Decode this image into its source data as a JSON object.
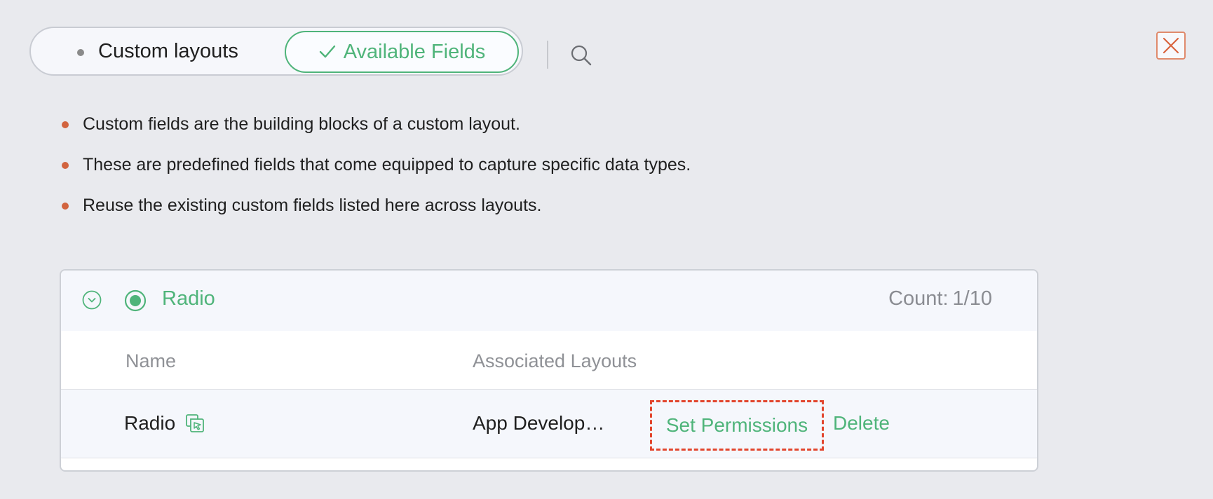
{
  "tabs": {
    "custom_layouts": "Custom layouts",
    "available_fields": "Available Fields"
  },
  "bullets": [
    "Custom fields are the building blocks of a custom layout.",
    "These are predefined fields that come equipped to capture specific data types.",
    "Reuse the existing custom fields listed here across layouts."
  ],
  "group": {
    "title": "Radio",
    "count_label": "Count:",
    "count_value": "1/10"
  },
  "table": {
    "headers": {
      "name": "Name",
      "layouts": "Associated Layouts"
    },
    "rows": [
      {
        "name": "Radio",
        "layouts": "App Develop…",
        "set_permissions": "Set Permissions",
        "delete": "Delete"
      }
    ]
  },
  "colors": {
    "accent_green": "#4fb47a",
    "bullet_orange": "#d2643f",
    "highlight_red": "#e2452d"
  },
  "icons": [
    "check-icon",
    "search-icon",
    "close-icon",
    "chevron-down-icon",
    "radio-icon",
    "copy-icon"
  ]
}
